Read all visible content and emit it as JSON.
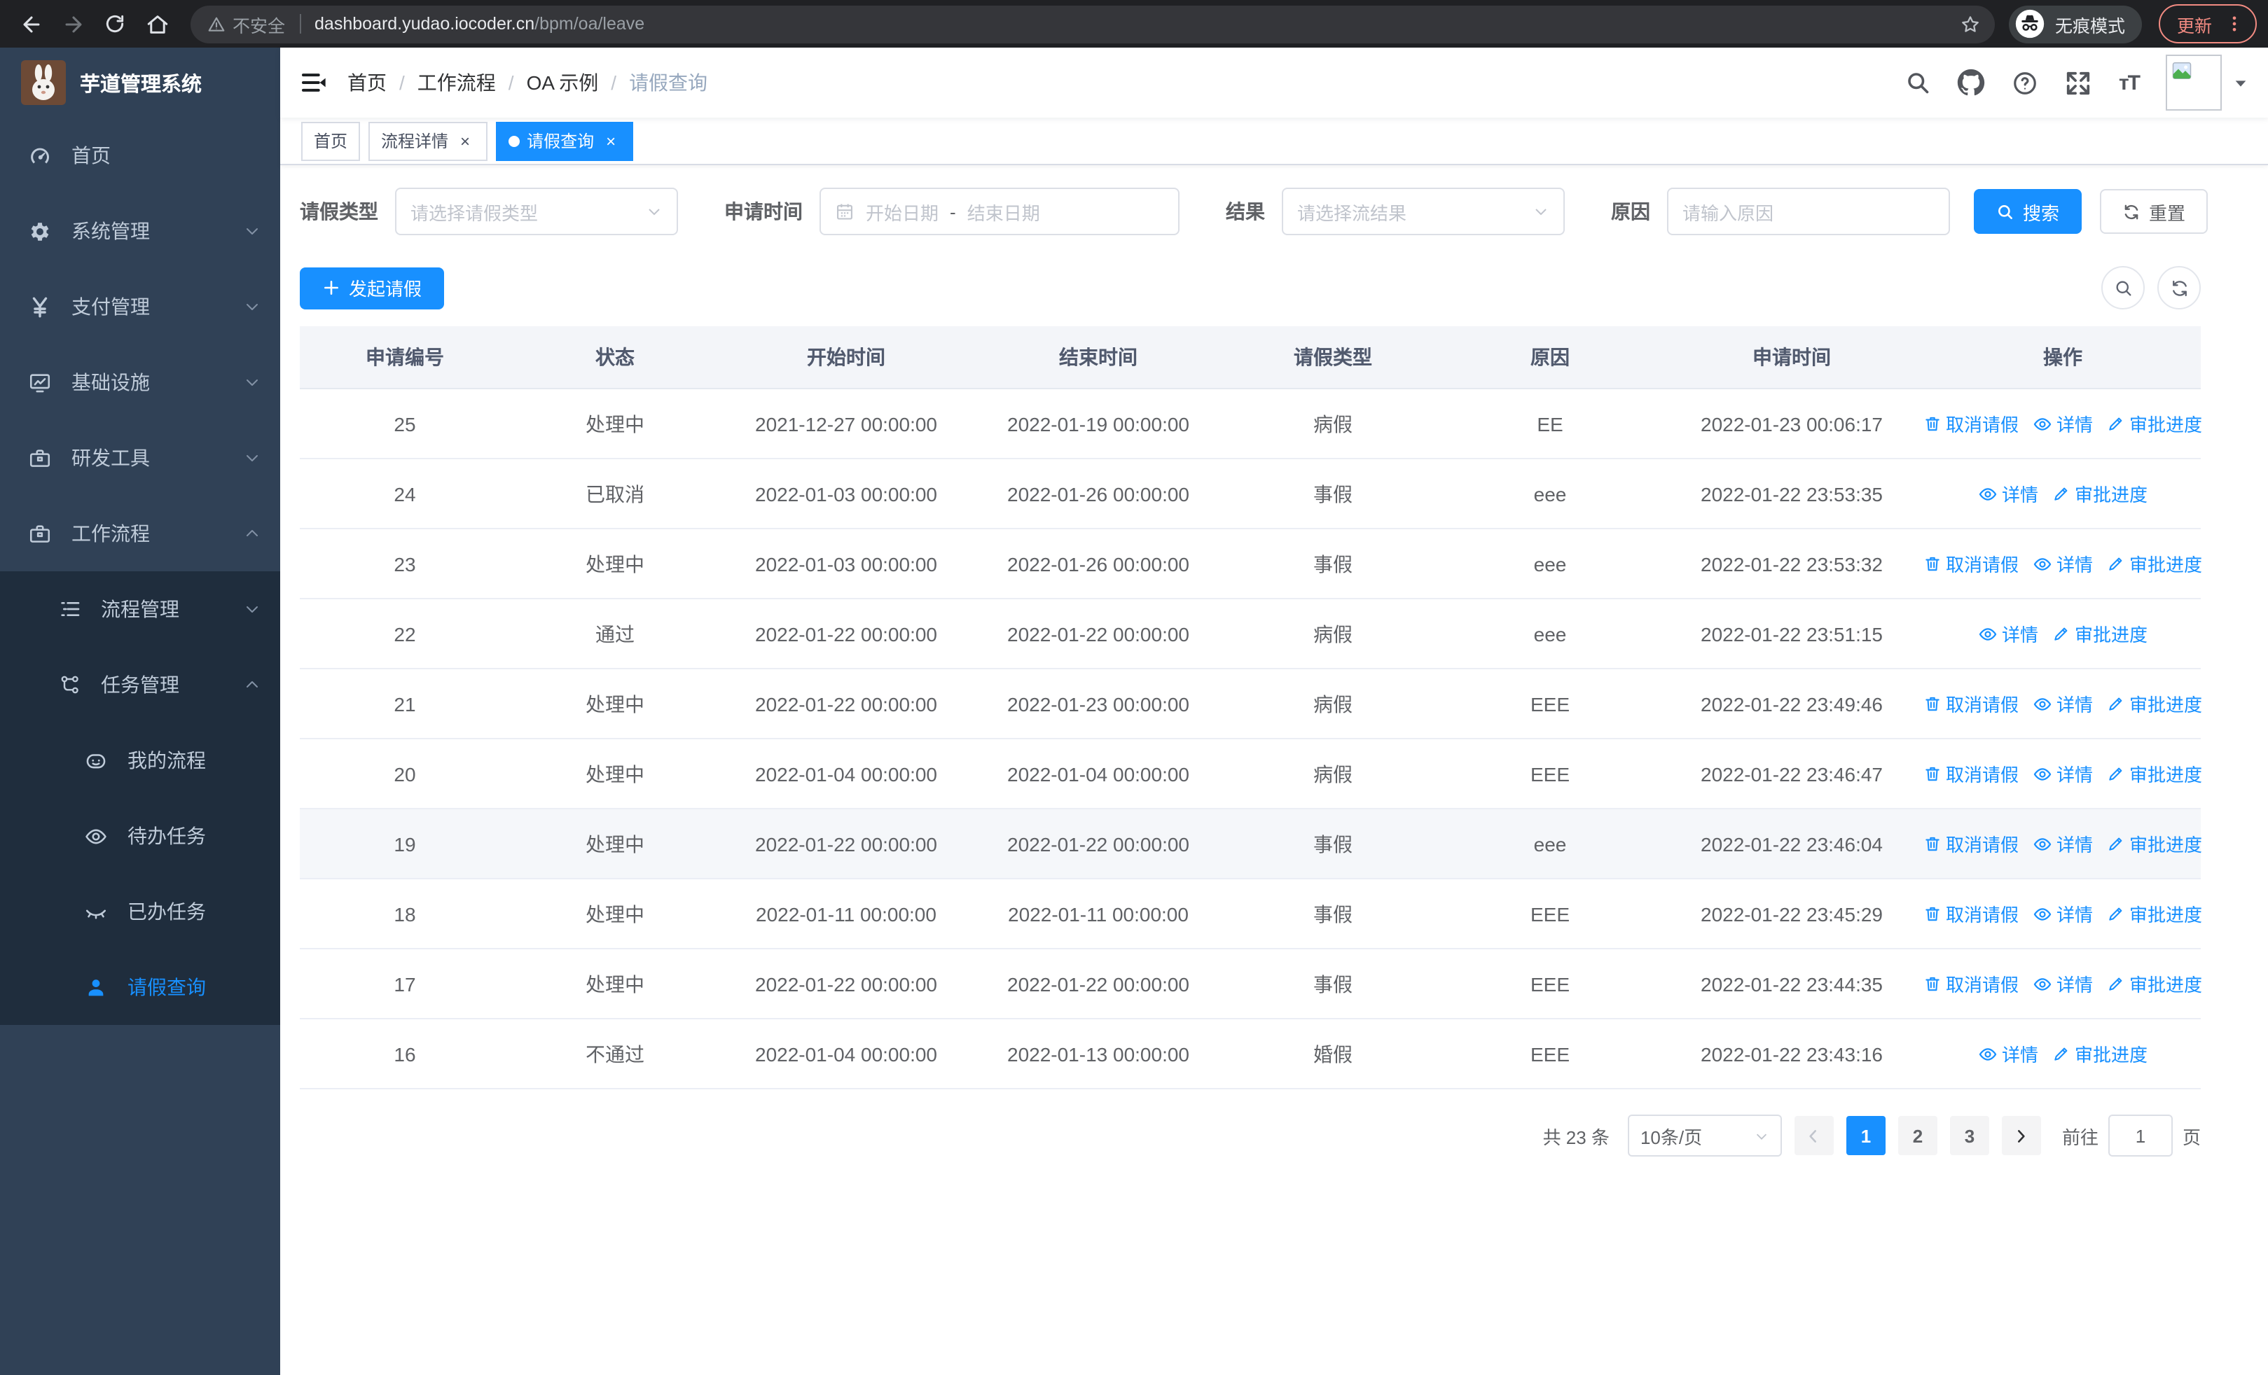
{
  "browser": {
    "security_warning": "不安全",
    "url_host": "dashboard.yudao.iocoder.cn",
    "url_path": "/bpm/oa/leave",
    "incognito_label": "无痕模式",
    "update_label": "更新"
  },
  "sidebar": {
    "title": "芋道管理系统",
    "items": [
      {
        "label": "首页",
        "icon": "dashboard-icon",
        "level": 0,
        "expandable": false,
        "sub": false,
        "active": false
      },
      {
        "label": "系统管理",
        "icon": "gear-icon",
        "level": 0,
        "expandable": true,
        "expanded": false,
        "sub": false,
        "active": false
      },
      {
        "label": "支付管理",
        "icon": "yen-icon",
        "level": 0,
        "expandable": true,
        "expanded": false,
        "sub": false,
        "active": false
      },
      {
        "label": "基础设施",
        "icon": "monitor-icon",
        "level": 0,
        "expandable": true,
        "expanded": false,
        "sub": false,
        "active": false
      },
      {
        "label": "研发工具",
        "icon": "toolbox-icon",
        "level": 0,
        "expandable": true,
        "expanded": false,
        "sub": false,
        "active": false
      },
      {
        "label": "工作流程",
        "icon": "briefcase-icon",
        "level": 0,
        "expandable": true,
        "expanded": true,
        "sub": false,
        "active": false
      },
      {
        "label": "流程管理",
        "icon": "list-tree-icon",
        "level": 1,
        "expandable": true,
        "expanded": false,
        "sub": true,
        "active": false
      },
      {
        "label": "任务管理",
        "icon": "flow-icon",
        "level": 1,
        "expandable": true,
        "expanded": true,
        "sub": true,
        "active": false
      },
      {
        "label": "我的流程",
        "icon": "robot-icon",
        "level": 2,
        "expandable": false,
        "sub": true,
        "active": false
      },
      {
        "label": "待办任务",
        "icon": "eye-open-icon",
        "level": 2,
        "expandable": false,
        "sub": true,
        "active": false
      },
      {
        "label": "已办任务",
        "icon": "eye-closed-icon",
        "level": 2,
        "expandable": false,
        "sub": true,
        "active": false
      },
      {
        "label": "请假查询",
        "icon": "user-icon",
        "level": 2,
        "expandable": false,
        "sub": true,
        "active": true
      }
    ]
  },
  "breadcrumb": [
    "首页",
    "工作流程",
    "OA 示例",
    "请假查询"
  ],
  "tags": [
    {
      "label": "首页",
      "active": false,
      "closable": false
    },
    {
      "label": "流程详情",
      "active": false,
      "closable": true
    },
    {
      "label": "请假查询",
      "active": true,
      "closable": true
    }
  ],
  "filters": {
    "leave_type_label": "请假类型",
    "leave_type_placeholder": "请选择请假类型",
    "apply_time_label": "申请时间",
    "start_date_placeholder": "开始日期",
    "date_separator": "-",
    "end_date_placeholder": "结束日期",
    "result_label": "结果",
    "result_placeholder": "请选择流结果",
    "reason_label": "原因",
    "reason_placeholder": "请输入原因",
    "search_label": "搜索",
    "reset_label": "重置"
  },
  "toolbar": {
    "create_label": "发起请假"
  },
  "table": {
    "columns": [
      "申请编号",
      "状态",
      "开始时间",
      "结束时间",
      "请假类型",
      "原因",
      "申请时间",
      "操作"
    ],
    "action_labels": {
      "cancel": "取消请假",
      "detail": "详情",
      "progress": "审批进度"
    },
    "rows": [
      {
        "id": "25",
        "status": "处理中",
        "start": "2021-12-27 00:00:00",
        "end": "2022-01-19 00:00:00",
        "type": "病假",
        "reason": "EE",
        "applied": "2022-01-23 00:06:17",
        "cancellable": true,
        "highlighted": false
      },
      {
        "id": "24",
        "status": "已取消",
        "start": "2022-01-03 00:00:00",
        "end": "2022-01-26 00:00:00",
        "type": "事假",
        "reason": "eee",
        "applied": "2022-01-22 23:53:35",
        "cancellable": false,
        "highlighted": false
      },
      {
        "id": "23",
        "status": "处理中",
        "start": "2022-01-03 00:00:00",
        "end": "2022-01-26 00:00:00",
        "type": "事假",
        "reason": "eee",
        "applied": "2022-01-22 23:53:32",
        "cancellable": true,
        "highlighted": false
      },
      {
        "id": "22",
        "status": "通过",
        "start": "2022-01-22 00:00:00",
        "end": "2022-01-22 00:00:00",
        "type": "病假",
        "reason": "eee",
        "applied": "2022-01-22 23:51:15",
        "cancellable": false,
        "highlighted": false
      },
      {
        "id": "21",
        "status": "处理中",
        "start": "2022-01-22 00:00:00",
        "end": "2022-01-23 00:00:00",
        "type": "病假",
        "reason": "EEE",
        "applied": "2022-01-22 23:49:46",
        "cancellable": true,
        "highlighted": false
      },
      {
        "id": "20",
        "status": "处理中",
        "start": "2022-01-04 00:00:00",
        "end": "2022-01-04 00:00:00",
        "type": "病假",
        "reason": "EEE",
        "applied": "2022-01-22 23:46:47",
        "cancellable": true,
        "highlighted": false
      },
      {
        "id": "19",
        "status": "处理中",
        "start": "2022-01-22 00:00:00",
        "end": "2022-01-22 00:00:00",
        "type": "事假",
        "reason": "eee",
        "applied": "2022-01-22 23:46:04",
        "cancellable": true,
        "highlighted": true
      },
      {
        "id": "18",
        "status": "处理中",
        "start": "2022-01-11 00:00:00",
        "end": "2022-01-11 00:00:00",
        "type": "事假",
        "reason": "EEE",
        "applied": "2022-01-22 23:45:29",
        "cancellable": true,
        "highlighted": false
      },
      {
        "id": "17",
        "status": "处理中",
        "start": "2022-01-22 00:00:00",
        "end": "2022-01-22 00:00:00",
        "type": "事假",
        "reason": "EEE",
        "applied": "2022-01-22 23:44:35",
        "cancellable": true,
        "highlighted": false
      },
      {
        "id": "16",
        "status": "不通过",
        "start": "2022-01-04 00:00:00",
        "end": "2022-01-13 00:00:00",
        "type": "婚假",
        "reason": "EEE",
        "applied": "2022-01-22 23:43:16",
        "cancellable": false,
        "highlighted": false
      }
    ]
  },
  "pagination": {
    "total": "共 23 条",
    "page_size": "10条/页",
    "pages": [
      "1",
      "2",
      "3"
    ],
    "active_page": "1",
    "goto_label": "前往",
    "goto_value": "1",
    "page_suffix": "页"
  },
  "colors": {
    "primary": "#1890ff",
    "sidebar_bg": "#304156",
    "submenu_bg": "#1f2d3d",
    "update_accent": "#f28b82",
    "row_highlight": "#f5f7fa"
  }
}
